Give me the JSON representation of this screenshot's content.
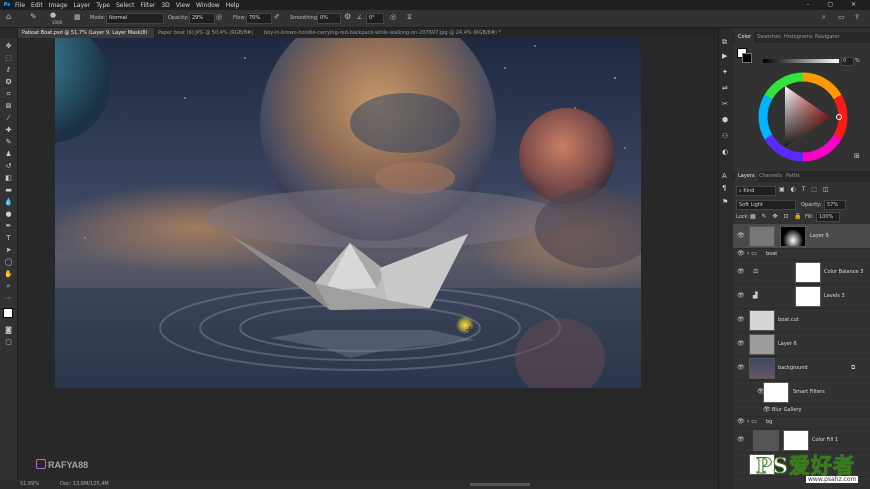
{
  "menubar": {
    "logo": "Ps",
    "items": [
      "File",
      "Edit",
      "Image",
      "Layer",
      "Type",
      "Select",
      "Filter",
      "3D",
      "View",
      "Window",
      "Help"
    ]
  },
  "options": {
    "brush_size": "1000",
    "mode_label": "Mode:",
    "mode_value": "Normal",
    "opacity_label": "Opacity:",
    "opacity_value": "29%",
    "flow_label": "Flow:",
    "flow_value": "70%",
    "smoothing_label": "Smoothing:",
    "smoothing_value": "0%",
    "angle_value": "0°"
  },
  "tabs": [
    {
      "label": "Paboat Boat.psd @ 51,7% (Layer 9, Layer Mask/8) *",
      "active": true
    },
    {
      "label": "Paper boat (6).JPG @ 50,4% (RGB/8#) *",
      "active": false
    },
    {
      "label": "boy-in-brown-hoodie-carrying-red-backpack-while-walking-on-207697.jpg @ 24,4% (RGB/8#) *",
      "active": false
    }
  ],
  "status": {
    "zoom": "51,69%",
    "doc": "Doc: 13,6M/125,4M"
  },
  "watermark": {
    "handle": "RAFYA88",
    "site_logo": "PS爱好者",
    "site_url": "www.psahz.com"
  },
  "color_panel": {
    "tabs": [
      "Color",
      "Swatches",
      "Histograms",
      "Navigator"
    ],
    "percent": "%",
    "slider_value": "0"
  },
  "layers_panel": {
    "tabs": [
      "Layers",
      "Channels",
      "Paths"
    ],
    "kind_label": "Kind",
    "blend_mode": "Soft Light",
    "opacity_label": "Opacity:",
    "opacity_value": "57%",
    "lock_label": "Lock:",
    "fill_label": "Fill:",
    "fill_value": "100%",
    "layers": [
      {
        "name": "Layer 9",
        "selected": true
      },
      {
        "name": "boat",
        "selected": false
      },
      {
        "name": "Color Balance 3",
        "selected": false
      },
      {
        "name": "Levels 3",
        "selected": false
      },
      {
        "name": "boat.cut",
        "selected": false
      },
      {
        "name": "Layer 6",
        "selected": false
      },
      {
        "name": "background",
        "selected": false
      },
      {
        "name": "Smart Filters",
        "selected": false
      },
      {
        "name": "Blur Gallery",
        "selected": false
      },
      {
        "name": "bg",
        "selected": false
      },
      {
        "name": "Color Fill 1",
        "selected": false
      }
    ]
  },
  "colors": {
    "accent": "#31a8ff",
    "panel_bg": "#323232",
    "app_bg": "#282828"
  }
}
